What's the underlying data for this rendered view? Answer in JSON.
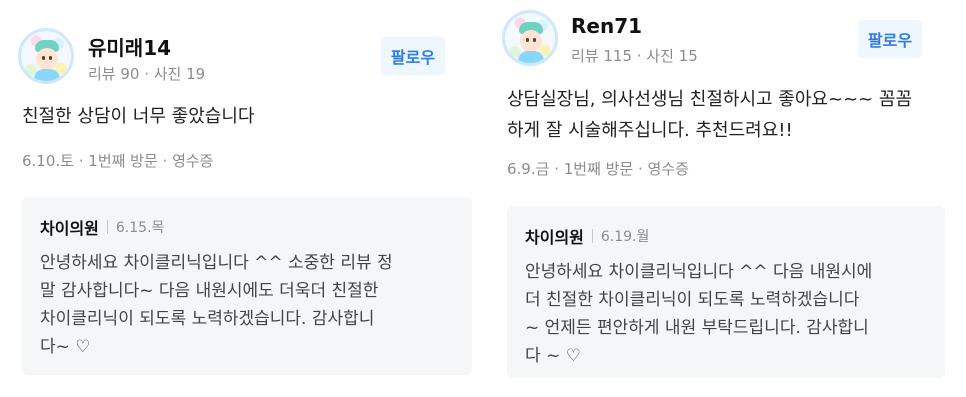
{
  "reviews": [
    {
      "user": {
        "name": "유미래14",
        "stats": "리뷰 90 · 사진 19",
        "avatar": "user-avatar"
      },
      "follow_label": "팔로우",
      "text": "친절한 상담이 너무 좋았습니다",
      "meta": "6.10.토 · 1번째 방문 · 영수증",
      "reply": {
        "author": "차이의원",
        "date": "6.15.목",
        "text": "안녕하세요 차이클리닉입니다 ^^ 소중한 리뷰 정\n말 감사합니다~ 다음 내원시에도 더욱더 친절한\n차이클리닉이 되도록 노력하겠습니다. 감사합니\n다~ ♡"
      }
    },
    {
      "user": {
        "name": "Ren71",
        "stats": "리뷰 115 · 사진 15",
        "avatar": "user-avatar"
      },
      "follow_label": "팔로우",
      "text": "상담실장님, 의사선생님 친절하시고 좋아요~~~ 꼼꼼\n하게 잘 시술해주십니다. 추천드려요!!",
      "meta": "6.9.금 · 1번째 방문 · 영수증",
      "reply": {
        "author": "차이의원",
        "date": "6.19.월",
        "text": "안녕하세요 차이클리닉입니다 ^^ 다음 내원시에\n더 친절한 차이클리닉이 되도록 노력하겠습니다\n~ 언제든 편안하게 내원 부탁드립니다. 감사합니\n다 ~ ♡"
      }
    }
  ]
}
